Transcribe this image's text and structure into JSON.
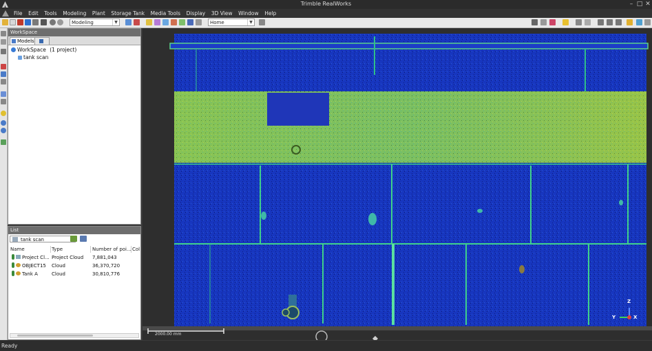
{
  "window": {
    "title": "Trimble RealWorks",
    "controls": [
      "minimize-icon",
      "maximize-icon",
      "close-icon"
    ]
  },
  "menubar": {
    "items": [
      "File",
      "Edit",
      "Tools",
      "Modeling",
      "Plant",
      "Storage Tank",
      "Media Tools",
      "Display",
      "3D View",
      "Window",
      "Help"
    ]
  },
  "toolbar": {
    "mode_select": "Modeling",
    "view_select": "Home"
  },
  "workspace": {
    "header": "WorkSpace",
    "tabs": [
      "Models",
      ""
    ],
    "tree": {
      "root": "WorkSpace",
      "root_count": "(1 project)",
      "child": "tank scan"
    }
  },
  "list": {
    "header": "List",
    "filter_value": "tank scan",
    "columns": [
      "Name",
      "Type",
      "Number of poi...",
      "Col"
    ],
    "rows": [
      {
        "name": "Project Cl...",
        "type": "Project Cloud",
        "points": "7,881,043"
      },
      {
        "name": "OBJECT15",
        "type": "Cloud",
        "points": "36,370,720"
      },
      {
        "name": "Tank A",
        "type": "Cloud",
        "points": "30,810,776"
      }
    ]
  },
  "viewport": {
    "scale_label": "2000.00 mm",
    "axis_labels": {
      "z": "Z",
      "y": "Y",
      "x": "X"
    }
  },
  "status": {
    "text": "Ready"
  },
  "colors": {
    "tank_blue": "#1432b8",
    "tank_band": "#7fc24a",
    "seam_green": "#3fd18a",
    "titlebar": "#2b2b2b",
    "toolbar": "#e8e8e8"
  }
}
